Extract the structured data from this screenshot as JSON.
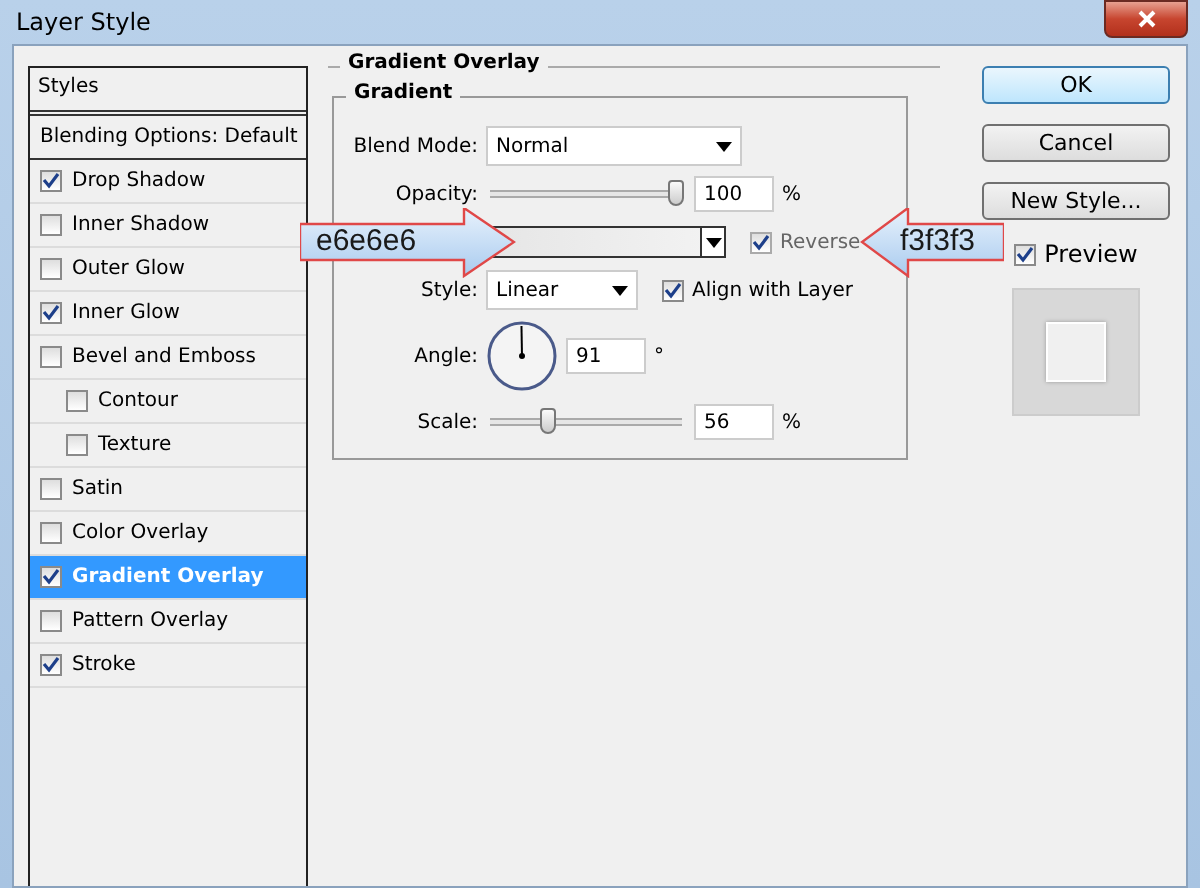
{
  "window": {
    "title": "Layer Style"
  },
  "styles_list": {
    "header": "Styles",
    "items": [
      {
        "label": "Blending Options: Default",
        "kind": "plain",
        "selected": false
      },
      {
        "label": "Drop Shadow",
        "kind": "check",
        "checked": true,
        "selected": false
      },
      {
        "label": "Inner Shadow",
        "kind": "check",
        "checked": false,
        "selected": false
      },
      {
        "label": "Outer Glow",
        "kind": "check",
        "checked": false,
        "selected": false
      },
      {
        "label": "Inner Glow",
        "kind": "check",
        "checked": true,
        "selected": false
      },
      {
        "label": "Bevel and Emboss",
        "kind": "check",
        "checked": false,
        "selected": false,
        "children": [
          {
            "label": "Contour",
            "kind": "check",
            "checked": false,
            "selected": false
          },
          {
            "label": "Texture",
            "kind": "check",
            "checked": false,
            "selected": false
          }
        ]
      },
      {
        "label": "Satin",
        "kind": "check",
        "checked": false,
        "selected": false
      },
      {
        "label": "Color Overlay",
        "kind": "check",
        "checked": false,
        "selected": false
      },
      {
        "label": "Gradient Overlay",
        "kind": "check",
        "checked": true,
        "selected": true
      },
      {
        "label": "Pattern Overlay",
        "kind": "check",
        "checked": false,
        "selected": false
      },
      {
        "label": "Stroke",
        "kind": "check",
        "checked": true,
        "selected": false
      }
    ]
  },
  "panel": {
    "title": "Gradient Overlay",
    "group_title": "Gradient",
    "blend_mode": {
      "label": "Blend Mode:",
      "value": "Normal"
    },
    "opacity": {
      "label": "Opacity:",
      "level": 0.97,
      "value": "100",
      "unit": "%"
    },
    "reverse": {
      "label": "Reverse",
      "checked": true,
      "disabled": true
    },
    "style": {
      "label": "Style:",
      "value": "Linear"
    },
    "align_with_layer": {
      "label": "Align with Layer",
      "checked": true
    },
    "angle": {
      "label": "Angle:",
      "value": "91",
      "unit": "°"
    },
    "scale": {
      "label": "Scale:",
      "level": 0.3,
      "value": "56",
      "unit": "%"
    }
  },
  "buttons": [
    {
      "label": "OK",
      "default": true
    },
    {
      "label": "Cancel",
      "default": false
    },
    {
      "label": "New Style...",
      "default": false
    }
  ],
  "preview": {
    "label": "Preview",
    "checked": true
  },
  "callouts": [
    {
      "text": "e6e6e6",
      "kind": "rightward"
    },
    {
      "text": "f3f3f3",
      "kind": "leftward"
    }
  ]
}
